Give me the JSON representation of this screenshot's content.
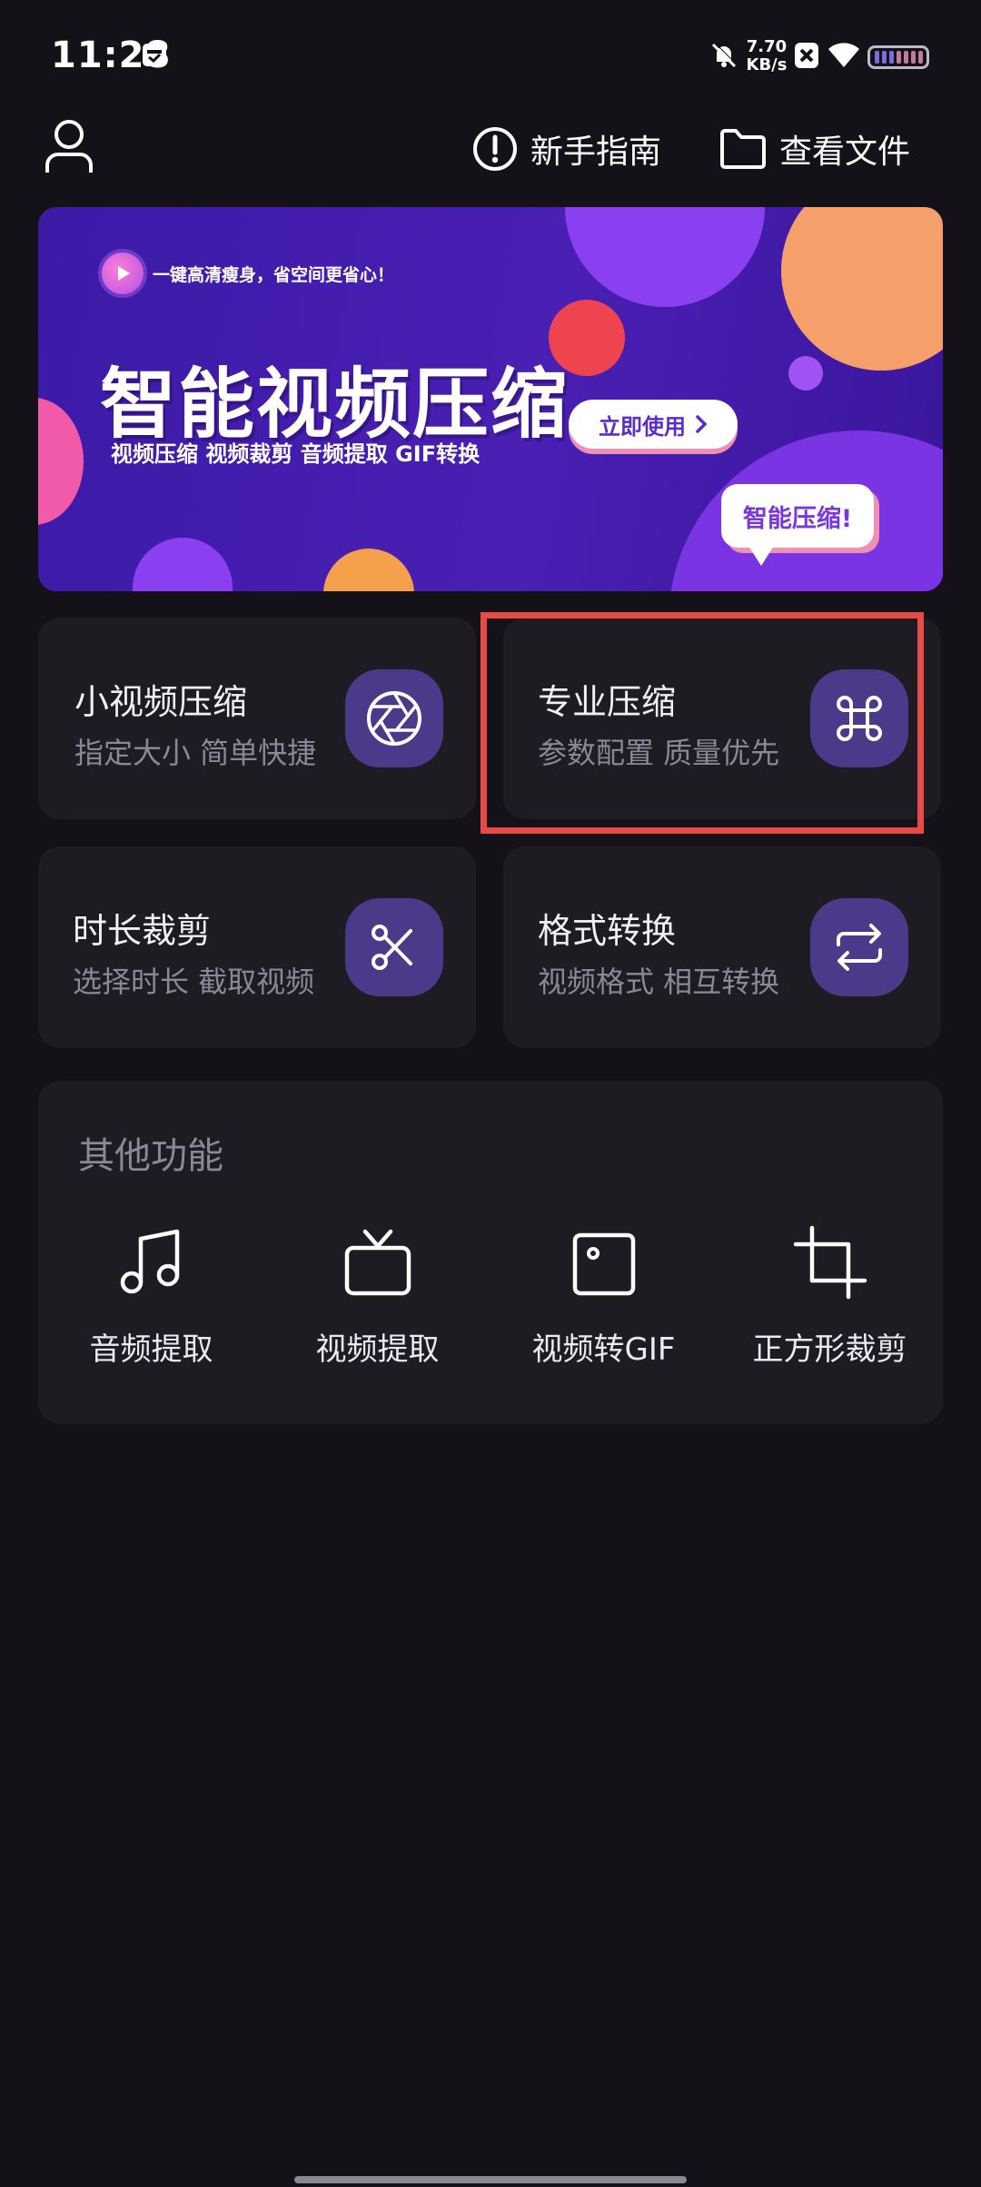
{
  "status_bar": {
    "time": "11:28",
    "net_speed_value": "7.70",
    "net_speed_unit": "KB/s"
  },
  "top_bar": {
    "guide_label": "新手指南",
    "files_label": "查看文件"
  },
  "banner": {
    "tagline": "一键高清瘦身，省空间更省心！",
    "title": "智能视频压缩",
    "subtitle": "视频压缩 视频裁剪 音频提取 GIF转换",
    "cta_label": "立即使用",
    "bubble_text": "智能压缩!"
  },
  "cards": [
    {
      "title": "小视频压缩",
      "subtitle": "指定大小 简单快捷",
      "icon": "aperture-icon"
    },
    {
      "title": "专业压缩",
      "subtitle": "参数配置 质量优先",
      "icon": "command-icon"
    },
    {
      "title": "时长裁剪",
      "subtitle": "选择时长 截取视频",
      "icon": "scissors-icon"
    },
    {
      "title": "格式转换",
      "subtitle": "视频格式 相互转换",
      "icon": "repeat-icon"
    }
  ],
  "other_functions": {
    "title": "其他功能",
    "items": [
      {
        "label": "音频提取",
        "icon": "music-icon"
      },
      {
        "label": "视频提取",
        "icon": "tv-icon"
      },
      {
        "label": "视频转GIF",
        "icon": "image-icon"
      },
      {
        "label": "正方形裁剪",
        "icon": "crop-icon"
      }
    ]
  },
  "colors": {
    "background": "#141118",
    "card": "#1e1b23",
    "icon_tile": "#4b3a89",
    "highlight": "#e84a46"
  }
}
